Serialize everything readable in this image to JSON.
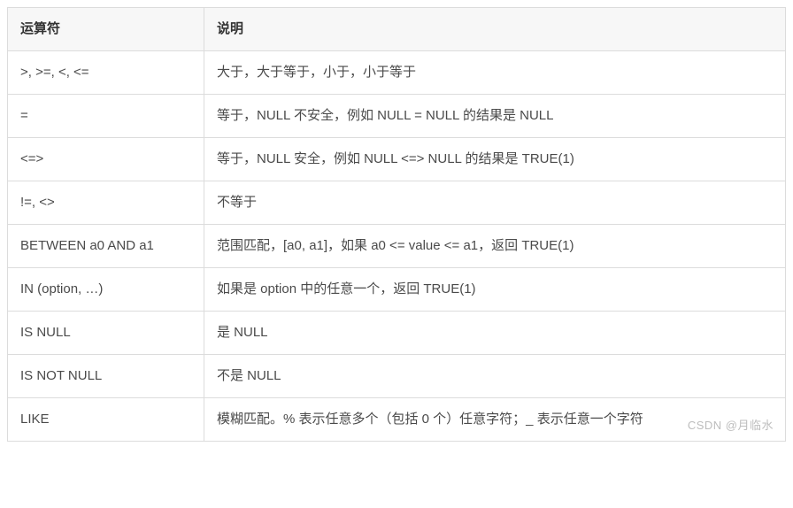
{
  "table": {
    "headers": [
      "运算符",
      "说明"
    ],
    "rows": [
      {
        "op": ">, >=, <, <=",
        "desc": "大于，大于等于，小于，小于等于"
      },
      {
        "op": "=",
        "desc": "等于，NULL 不安全，例如 NULL = NULL 的结果是 NULL"
      },
      {
        "op": "<=>",
        "desc": "等于，NULL 安全，例如 NULL <=> NULL 的结果是 TRUE(1)"
      },
      {
        "op": "!=, <>",
        "desc": "不等于"
      },
      {
        "op": "BETWEEN a0 AND a1",
        "desc": "范围匹配，[a0, a1]，如果 a0 <= value <= a1，返回 TRUE(1)"
      },
      {
        "op": "IN (option, …)",
        "desc": "如果是 option 中的任意一个，返回 TRUE(1)"
      },
      {
        "op": "IS NULL",
        "desc": "是 NULL"
      },
      {
        "op": "IS NOT NULL",
        "desc": "不是 NULL"
      },
      {
        "op": "LIKE",
        "desc": "模糊匹配。% 表示任意多个（包括 0 个）任意字符；_ 表示任意一个字符"
      }
    ]
  },
  "watermark": "CSDN @月临水"
}
